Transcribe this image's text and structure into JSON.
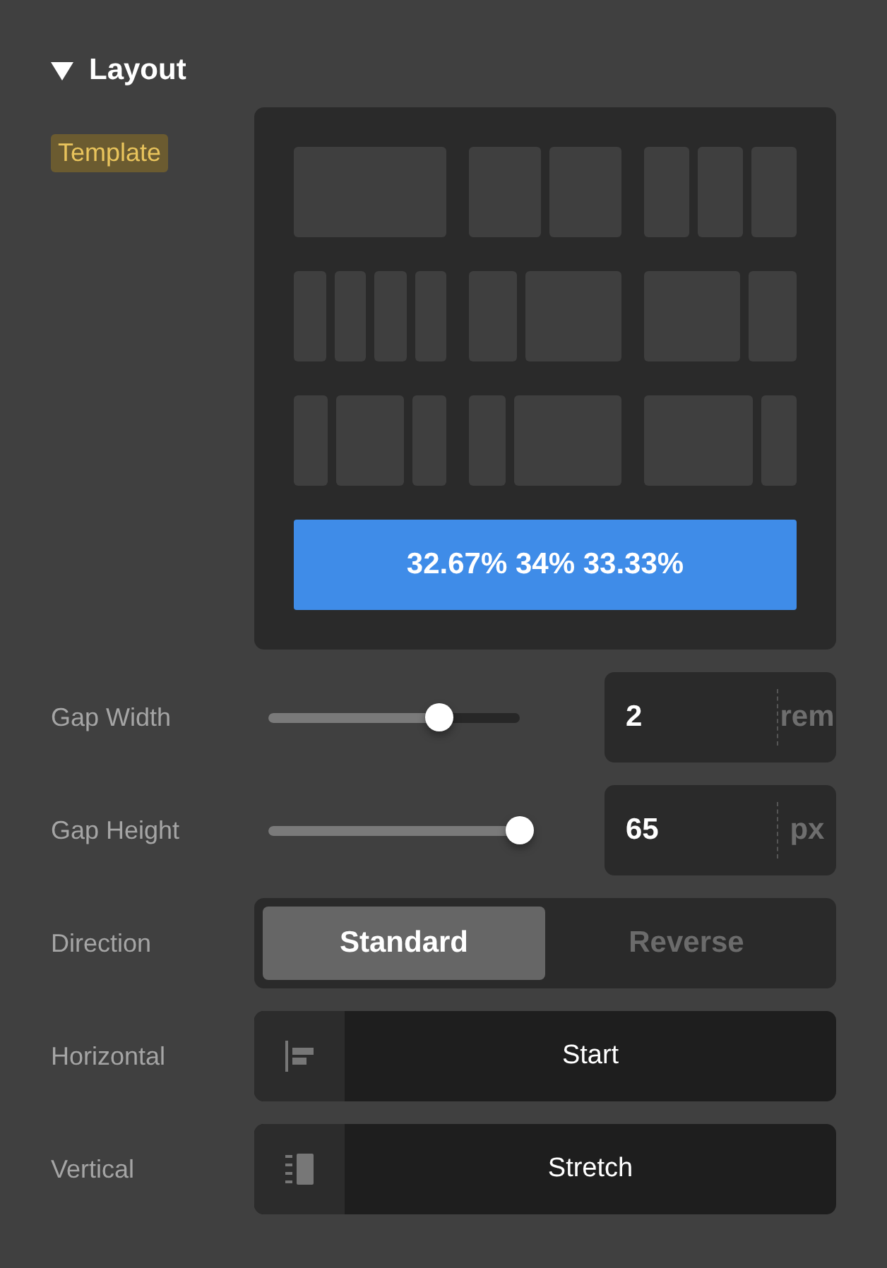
{
  "section": {
    "title": "Layout",
    "expanded": true
  },
  "template": {
    "label": "Template",
    "value": "32.67% 34% 33.33%"
  },
  "sliders": [
    {
      "label": "Gap Width",
      "level": 0.68,
      "value": "2",
      "unit": "rem"
    },
    {
      "label": "Gap Height",
      "level": 1,
      "value": "65",
      "unit": "px"
    }
  ],
  "direction": {
    "label": "Direction",
    "options": [
      {
        "label": "Standard",
        "selected": true
      },
      {
        "label": "Reverse",
        "selected": false
      }
    ]
  },
  "alignments": [
    {
      "label": "Horizontal",
      "kind": "start",
      "value": "Start"
    },
    {
      "label": "Vertical",
      "kind": "stretch",
      "value": "Stretch"
    }
  ]
}
